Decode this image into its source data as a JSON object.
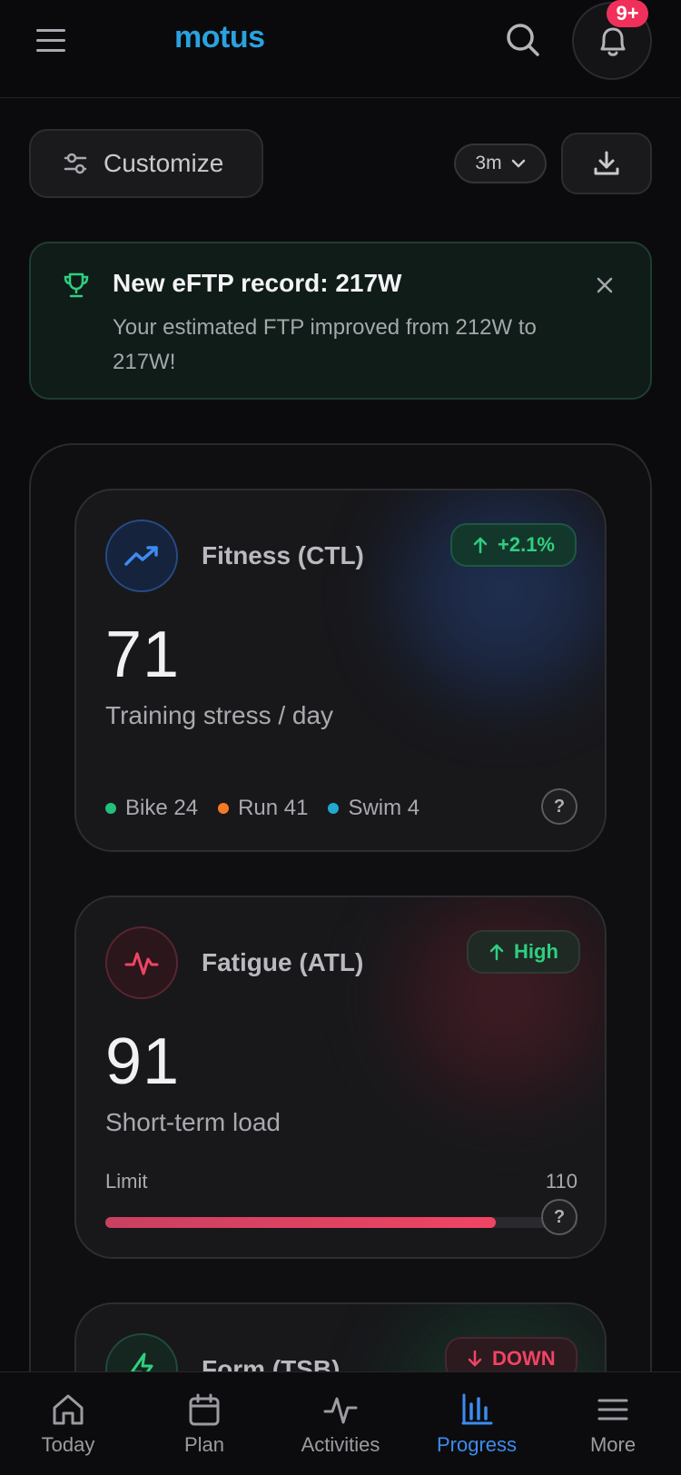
{
  "header": {
    "logo": "motus",
    "notification_count": "9+"
  },
  "toolbar": {
    "customize_label": "Customize",
    "range_value": "3m"
  },
  "banner": {
    "title": "New eFTP record: 217W",
    "message": "Your estimated FTP improved from 212W to 217W!"
  },
  "cards": {
    "fitness": {
      "title": "Fitness (CTL)",
      "change": "+2.1%",
      "value": "71",
      "subtitle": "Training stress / day",
      "breakdown": [
        {
          "label": "Bike 24",
          "color": "#22c07a"
        },
        {
          "label": "Run 41",
          "color": "#f57a25"
        },
        {
          "label": "Swim 4",
          "color": "#20a8d0"
        }
      ]
    },
    "fatigue": {
      "title": "Fatigue (ATL)",
      "status": "High",
      "value": "91",
      "subtitle": "Short-term load",
      "limit_label": "Limit",
      "limit_value": "110",
      "load_fraction": 0.827
    },
    "form": {
      "title": "Form (TSB)",
      "status": "DOWN"
    }
  },
  "colors": {
    "accent_blue": "#3d8bf0",
    "positive_green": "#2fcf7f",
    "negative_red": "#f04464"
  },
  "nav": {
    "items": [
      {
        "label": "Today",
        "icon": "home-icon"
      },
      {
        "label": "Plan",
        "icon": "calendar-icon"
      },
      {
        "label": "Activities",
        "icon": "activity-icon"
      },
      {
        "label": "Progress",
        "icon": "bar-chart-icon"
      },
      {
        "label": "More",
        "icon": "menu-icon"
      }
    ],
    "active": "Progress"
  }
}
